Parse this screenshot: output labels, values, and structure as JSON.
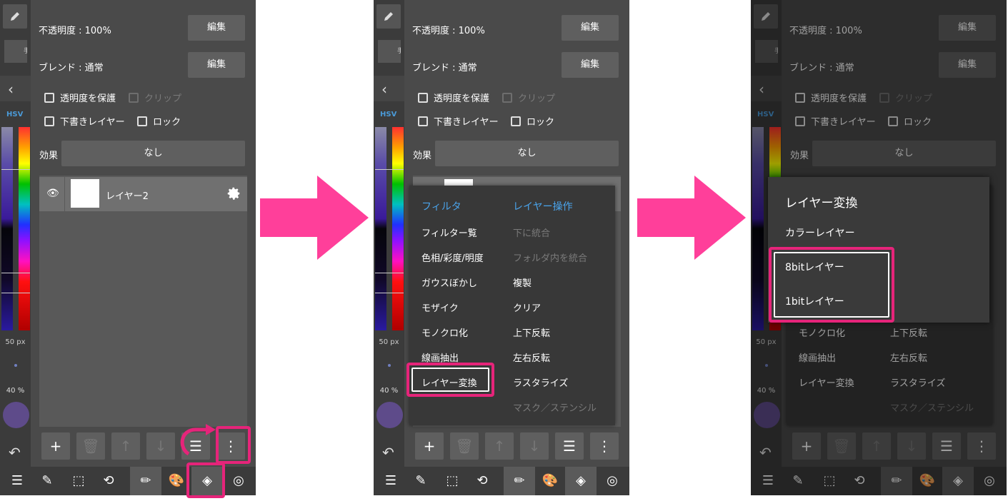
{
  "panel": {
    "opacity_label": "不透明度 : 100%",
    "blend_label": "ブレンド : 通常",
    "edit_label": "編集",
    "protect_alpha": "透明度を保護",
    "clip": "クリップ",
    "draft_layer": "下書きレイヤー",
    "lock": "ロック",
    "effect_label": "効果",
    "effect_value": "なし",
    "layer_name": "レイヤー2",
    "hsv": "HSV",
    "brush_size": "50 px",
    "brush_opacity": "40 %",
    "hand_tool": "手ぶ"
  },
  "filter_menu": {
    "header": "フィルタ",
    "items": [
      "フィルター覧",
      "色相/彩度/明度",
      "ガウスぼかし",
      "モザイク",
      "モノクロ化",
      "線画抽出",
      "レイヤー変換"
    ]
  },
  "layer_menu": {
    "header": "レイヤー操作",
    "items": [
      "下に統合",
      "フォルダ内を統合",
      "複製",
      "クリア",
      "上下反転",
      "左右反転",
      "ラスタライズ",
      "マスク／ステンシル"
    ],
    "disabled": [
      true,
      true,
      false,
      false,
      false,
      false,
      false,
      true
    ]
  },
  "dialog": {
    "title": "レイヤー変換",
    "options": [
      "カラーレイヤー",
      "8bitレイヤー",
      "1bitレイヤー"
    ]
  },
  "colors": {
    "highlight": "#e6247a",
    "menu_header": "#4aa4ec",
    "panel_bg": "#4a4a4a"
  }
}
